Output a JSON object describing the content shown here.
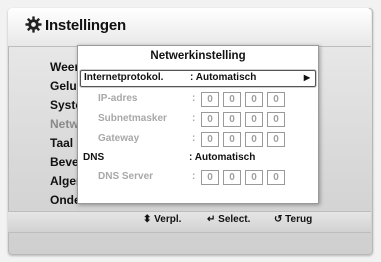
{
  "header": {
    "title": "Instellingen",
    "icon": "gear-icon"
  },
  "background_menu": {
    "items": [
      {
        "label": "Weerg",
        "dim": false
      },
      {
        "label": "Geluid",
        "dim": false
      },
      {
        "label": "Syste",
        "dim": false
      },
      {
        "label": "Netw",
        "dim": true
      },
      {
        "label": "Taal",
        "dim": false
      },
      {
        "label": "Bevei",
        "dim": false
      },
      {
        "label": "Algem",
        "dim": false
      },
      {
        "label": "Onder",
        "dim": false
      }
    ]
  },
  "dialog": {
    "title": "Netwerkinstelling",
    "protocol": {
      "label": "Internetprotokol.",
      "value": ": Automatisch"
    },
    "ip": {
      "label": "IP-adres",
      "colon": ":",
      "octets": [
        "0",
        "0",
        "0",
        "0"
      ]
    },
    "subnet": {
      "label": "Subnetmasker",
      "colon": ":",
      "octets": [
        "0",
        "0",
        "0",
        "0"
      ]
    },
    "gateway": {
      "label": "Gateway",
      "colon": ":",
      "octets": [
        "0",
        "0",
        "0",
        "0"
      ]
    },
    "dns": {
      "label": "DNS",
      "value": ": Automatisch"
    },
    "dns_server": {
      "label": "DNS Server",
      "colon": ":",
      "octets": [
        "0",
        "0",
        "0",
        "0"
      ]
    },
    "footer": {
      "move": "⬍ Verpl.",
      "select": "↵ Select.",
      "back": "↺ Terug"
    }
  }
}
